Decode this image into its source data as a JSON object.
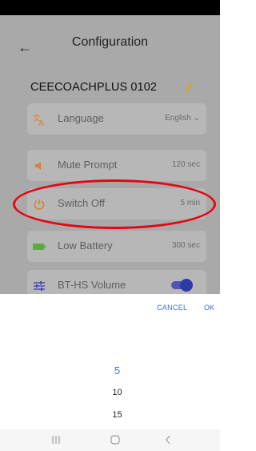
{
  "header": {
    "title": "Configuration"
  },
  "device": {
    "name": "CEECOACHPLUS 0102"
  },
  "settings": [
    {
      "label": "Language",
      "value": "English ⌄"
    },
    {
      "label": "Mute Prompt",
      "value": "120 sec"
    },
    {
      "label": "Switch Off",
      "value": "5 min"
    },
    {
      "label": "Low Battery",
      "value": "300 sec"
    },
    {
      "label": "BT-HS Volume",
      "toggle_on": true
    }
  ],
  "picker": {
    "cancel_label": "CANCEL",
    "ok_label": "OK",
    "options": [
      "5",
      "10",
      "15"
    ],
    "selected": "5"
  },
  "colors": {
    "highlight": "#e30613",
    "accent": "#3a73e6",
    "toggle": "#2e3aa6"
  },
  "icons": {
    "back": "arrow-left-icon",
    "edit": "pencil-icon",
    "language": "translate-icon",
    "mute": "speaker-icon",
    "switch_off": "power-icon",
    "battery": "battery-icon",
    "volume": "sliders-icon"
  }
}
